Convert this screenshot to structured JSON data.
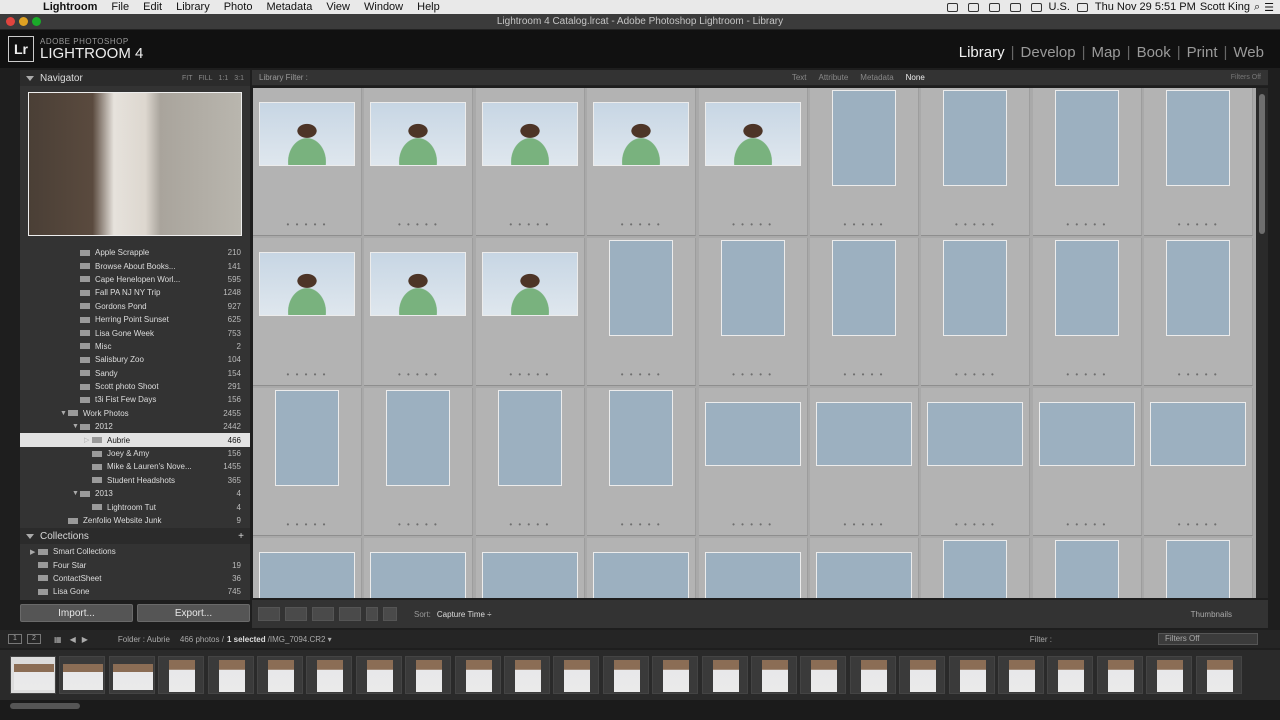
{
  "menubar": {
    "app": "Lightroom",
    "items": [
      "File",
      "Edit",
      "Library",
      "Photo",
      "Metadata",
      "View",
      "Window",
      "Help"
    ],
    "input_source": "U.S.",
    "clock": "Thu Nov 29  5:51 PM",
    "user": "Scott King"
  },
  "window": {
    "title": "Lightroom 4 Catalog.lrcat - Adobe Photoshop Lightroom - Library"
  },
  "identity": {
    "logo": "Lr",
    "small": "ADOBE PHOTOSHOP",
    "big": "LIGHTROOM 4",
    "modules": [
      "Library",
      "Develop",
      "Map",
      "Book",
      "Print",
      "Web"
    ],
    "active_module": "Library"
  },
  "navigator": {
    "title": "Navigator",
    "options": [
      "FIT",
      "FILL",
      "1:1",
      "3:1"
    ]
  },
  "folders": [
    {
      "label": "Apple Scrapple",
      "count": "210",
      "indent": 2,
      "tri": ""
    },
    {
      "label": "Browse About Books...",
      "count": "141",
      "indent": 2,
      "tri": ""
    },
    {
      "label": "Cape Henelopen Worl...",
      "count": "595",
      "indent": 2,
      "tri": ""
    },
    {
      "label": "Fall PA NJ NY Trip",
      "count": "1248",
      "indent": 2,
      "tri": ""
    },
    {
      "label": "Gordons Pond",
      "count": "927",
      "indent": 2,
      "tri": ""
    },
    {
      "label": "Herring Point Sunset",
      "count": "625",
      "indent": 2,
      "tri": ""
    },
    {
      "label": "Lisa Gone Week",
      "count": "753",
      "indent": 2,
      "tri": ""
    },
    {
      "label": "Misc",
      "count": "2",
      "indent": 2,
      "tri": ""
    },
    {
      "label": "Salisbury Zoo",
      "count": "104",
      "indent": 2,
      "tri": ""
    },
    {
      "label": "Sandy",
      "count": "154",
      "indent": 2,
      "tri": ""
    },
    {
      "label": "Scott photo Shoot",
      "count": "291",
      "indent": 2,
      "tri": ""
    },
    {
      "label": "t3i Fist Few Days",
      "count": "156",
      "indent": 2,
      "tri": ""
    },
    {
      "label": "Work Photos",
      "count": "2455",
      "indent": 1,
      "tri": "▼"
    },
    {
      "label": "2012",
      "count": "2442",
      "indent": 2,
      "tri": "▼"
    },
    {
      "label": "Aubrie",
      "count": "466",
      "indent": 3,
      "tri": "▷",
      "selected": true
    },
    {
      "label": "Joey & Amy",
      "count": "156",
      "indent": 3,
      "tri": ""
    },
    {
      "label": "Mike & Lauren's Nove...",
      "count": "1455",
      "indent": 3,
      "tri": ""
    },
    {
      "label": "Student Headshots",
      "count": "365",
      "indent": 3,
      "tri": ""
    },
    {
      "label": "2013",
      "count": "4",
      "indent": 2,
      "tri": "▼"
    },
    {
      "label": "Lightroom Tut",
      "count": "4",
      "indent": 3,
      "tri": ""
    },
    {
      "label": "Zenfolio Website Junk",
      "count": "9",
      "indent": 1,
      "tri": ""
    }
  ],
  "collections": {
    "title": "Collections",
    "items": [
      {
        "label": "Smart Collections",
        "count": "",
        "tri": "▶"
      },
      {
        "label": "Four Star",
        "count": "19",
        "tri": ""
      },
      {
        "label": "ContactSheet",
        "count": "36",
        "tri": ""
      },
      {
        "label": "Lisa Gone",
        "count": "745",
        "tri": ""
      }
    ]
  },
  "buttons": {
    "import": "Import...",
    "export": "Export..."
  },
  "filterbar": {
    "label": "Library Filter :",
    "options": [
      "Text",
      "Attribute",
      "Metadata",
      "None"
    ],
    "active": "None",
    "right": "Filters Off"
  },
  "grid": {
    "rows": [
      [
        "land-sky",
        "land-sky",
        "land-sky",
        "land-sky",
        "land-sky",
        "port-green",
        "port-green",
        "port-green",
        "port-green"
      ],
      [
        "land-sky",
        "land-sky",
        "land-sky",
        "port-green",
        "port-green",
        "port-green",
        "port-green",
        "port-green",
        "port-green"
      ],
      [
        "port-green",
        "port-green",
        "port-green",
        "port-green",
        "land-brick",
        "land-brick",
        "land-brick",
        "land-brick",
        "land-brick"
      ],
      [
        "land-brick",
        "land-brick",
        "land-brick",
        "land-brick",
        "land-brick",
        "land-brick",
        "port-green",
        "port-green",
        "port-green"
      ]
    ],
    "dots": "• • • • •"
  },
  "toolbar": {
    "sort_label": "Sort:",
    "sort_value": "Capture Time ÷",
    "thumbnails": "Thumbnails"
  },
  "filmstrip": {
    "view1": "1",
    "view2": "2",
    "folder": "Folder : Aubrie",
    "count_prefix": "466 photos /",
    "count_selected": "1 selected",
    "count_file": "/IMG_7094.CR2 ▾",
    "filter_label": "Filter :",
    "filters_off": "Filters Off",
    "thumbs": 25,
    "selected_index": 0
  }
}
